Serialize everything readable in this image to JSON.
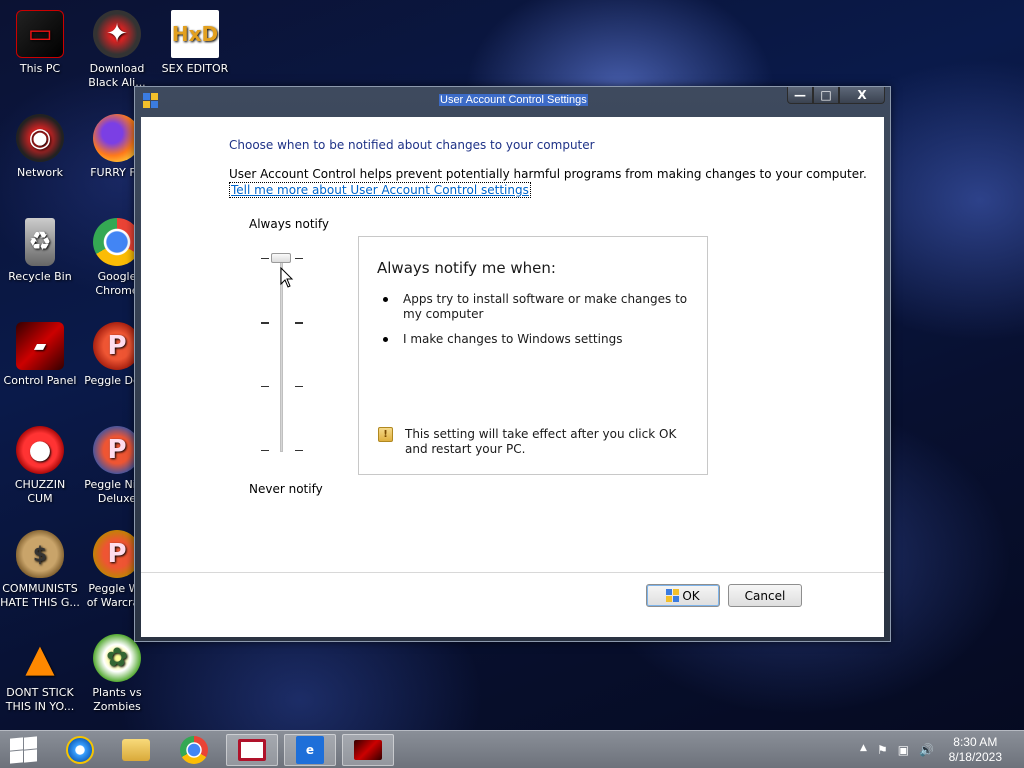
{
  "desktop": {
    "icons": [
      {
        "label": "This PC"
      },
      {
        "label": "Download\nBlack Ali..."
      },
      {
        "label": "SEX EDITOR"
      },
      {
        "label": "Network"
      },
      {
        "label": "FURRY FU"
      },
      {
        "label": "Recycle Bin"
      },
      {
        "label": "Google\nChrome"
      },
      {
        "label": "Control Panel"
      },
      {
        "label": "Peggle Delu"
      },
      {
        "label": "CHUZZIN\nCUM"
      },
      {
        "label": "Peggle Nigh\nDeluxe"
      },
      {
        "label": "COMMUNISTS\nHATE THIS G..."
      },
      {
        "label": "Peggle Wo\nof Warcraft"
      },
      {
        "label": "DONT STICK\nTHIS IN YO..."
      },
      {
        "label": "Plants vs\nZombies"
      }
    ]
  },
  "window": {
    "title": "User Account Control Settings",
    "caption": {
      "minimize": "—",
      "maximize": "□",
      "close": "X"
    },
    "heading": "Choose when to be notified about changes to your computer",
    "description": "User Account Control helps prevent potentially harmful programs from making changes to your computer.",
    "learn_more_link": "Tell me more about User Account Control settings",
    "slider": {
      "top_label": "Always notify",
      "bottom_label": "Never notify",
      "levels": 4,
      "selected_level": 4
    },
    "info": {
      "title": "Always notify me when:",
      "bullets": [
        "Apps try to install software or make changes to my computer",
        "I make changes to Windows settings"
      ],
      "note": "This setting will take effect after you click OK and restart your PC."
    },
    "buttons": {
      "ok": "OK",
      "cancel": "Cancel"
    }
  },
  "taskbar": {
    "time": "8:30 AM",
    "date": "8/18/2023",
    "tray": {
      "chevron": "▲",
      "flag": "⚑",
      "network": "▣",
      "volume": "🔊"
    }
  },
  "colors": {
    "heading": "#1e3287",
    "link": "#0066cc",
    "title_highlight": "#3c6bc7"
  }
}
